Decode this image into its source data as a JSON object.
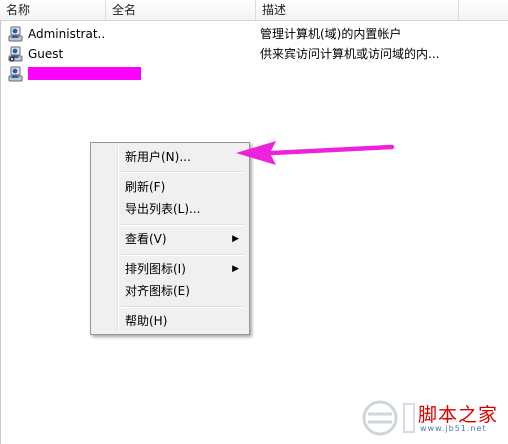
{
  "columns": {
    "name": "名称",
    "fullname": "全名",
    "description": "描述"
  },
  "rows": [
    {
      "name": "Administrat...",
      "fullname": "",
      "description": "管理计算机(域)的内置帐户",
      "icon": "user-icon"
    },
    {
      "name": "Guest",
      "fullname": "",
      "description": "供来宾访问计算机或访问域的内...",
      "icon": "guest-user-icon"
    },
    {
      "name": "",
      "fullname": "",
      "description": "",
      "icon": "user-icon",
      "redacted": true
    }
  ],
  "context_menu": {
    "new_user": "新用户(N)...",
    "refresh": "刷新(F)",
    "export_list": "导出列表(L)...",
    "view": "查看(V)",
    "arrange_icons": "排列图标(I)",
    "align_icons": "对齐图标(E)",
    "help": "帮助(H)"
  },
  "watermark": {
    "site_name": "脚本之家",
    "site_url": "www.jb51.net"
  },
  "colors": {
    "annotation_arrow": "#ee22dd",
    "redaction": "#ff00ff",
    "watermark_red": "#d90000"
  }
}
